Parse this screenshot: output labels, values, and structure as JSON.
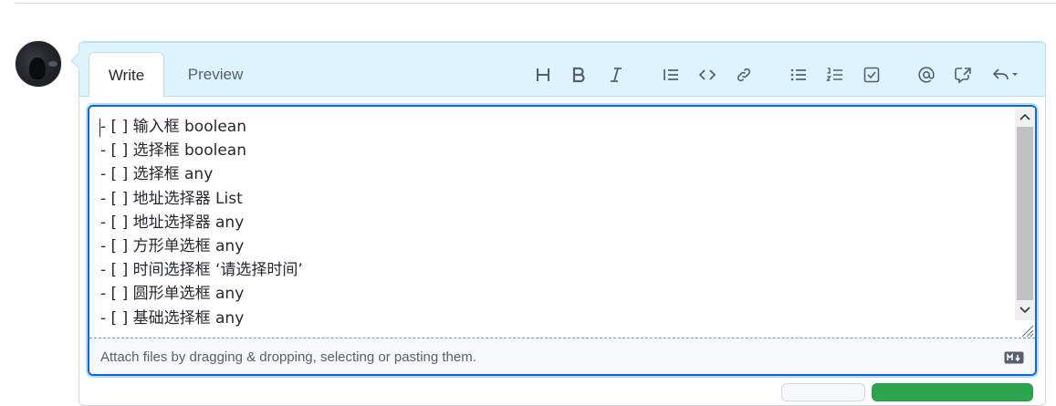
{
  "tabs": {
    "write": "Write",
    "preview": "Preview"
  },
  "toolbar": [
    "heading-icon",
    "bold-icon",
    "italic-icon",
    "quote-icon",
    "code-icon",
    "link-icon",
    "unordered-list-icon",
    "ordered-list-icon",
    "task-list-icon",
    "mention-icon",
    "cross-reference-icon",
    "reply-icon"
  ],
  "editor": {
    "lines": [
      "- [ ] 输入框 boolean",
      "- [ ] 选择框 boolean",
      "- [ ] 选择框 any",
      "- [ ] 地址选择器 List",
      "- [ ] 地址选择器 any",
      "- [ ] 方形单选框 any",
      "- [ ] 时间选择框 ‘请选择时间’",
      "- [ ] 圆形单选框 any",
      "- [ ] 基础选择框 any"
    ]
  },
  "attach": {
    "text": "Attach files by dragging & dropping, selecting or pasting them."
  },
  "colors": {
    "accent": "#0969da",
    "header_bg": "#ddf4ff",
    "primary_button": "#2da44e"
  }
}
